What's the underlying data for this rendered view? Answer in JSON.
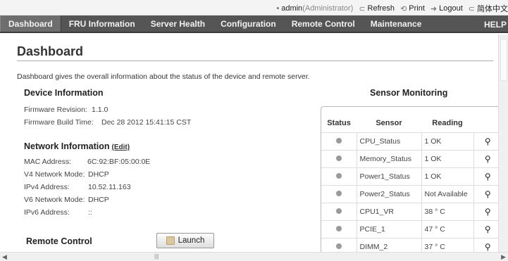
{
  "toplinks": {
    "user": "admin",
    "role": "(Administrator)",
    "refresh": "Refresh",
    "print": "Print",
    "logout": "Logout",
    "language": "简体中文"
  },
  "nav": {
    "tabs": [
      {
        "label": "Dashboard"
      },
      {
        "label": "FRU Information"
      },
      {
        "label": "Server Health"
      },
      {
        "label": "Configuration"
      },
      {
        "label": "Remote Control"
      },
      {
        "label": "Maintenance"
      }
    ],
    "help": "HELP"
  },
  "page": {
    "title": "Dashboard",
    "description": "Dashboard gives the overall information about the status of the device and remote server."
  },
  "device": {
    "heading": "Device Information",
    "firmware_revision_label": "Firmware Revision:",
    "firmware_revision": "1.1.0",
    "firmware_build_label": "Firmware Build Time:",
    "firmware_build": "Dec 28 2012 15:41:15 CST"
  },
  "network": {
    "heading": "Network Information",
    "edit": "(Edit)",
    "mac_label": "MAC Address:",
    "mac": "6C:92:BF:05:00:0E",
    "v4_mode_label": "V4 Network Mode:",
    "v4_mode": "DHCP",
    "ipv4_label": "IPv4 Address:",
    "ipv4": "10.52.11.163",
    "v6_mode_label": "V6 Network Mode:",
    "v6_mode": "DHCP",
    "ipv6_label": "IPv6 Address:",
    "ipv6": "::"
  },
  "remote": {
    "heading": "Remote Control",
    "launch": "Launch"
  },
  "sensors": {
    "heading": "Sensor Monitoring",
    "columns": {
      "status": "Status",
      "sensor": "Sensor",
      "reading": "Reading"
    },
    "rows": [
      {
        "name": "CPU_Status",
        "reading": "1 OK"
      },
      {
        "name": "Memory_Status",
        "reading": "1 OK"
      },
      {
        "name": "Power1_Status",
        "reading": "1 OK"
      },
      {
        "name": "Power2_Status",
        "reading": "Not Available"
      },
      {
        "name": "CPU1_VR",
        "reading": "38 ° C"
      },
      {
        "name": "PCIE_1",
        "reading": "47 ° C"
      },
      {
        "name": "DIMM_2",
        "reading": "37 ° C"
      }
    ],
    "status_color": "#9a9a9a"
  },
  "icons": {
    "user": "user-icon",
    "refresh": "refresh-icon",
    "print": "print-icon",
    "logout": "logout-icon",
    "language": "language-icon",
    "details": "magnifier-icon",
    "launch": "launch-icon"
  }
}
